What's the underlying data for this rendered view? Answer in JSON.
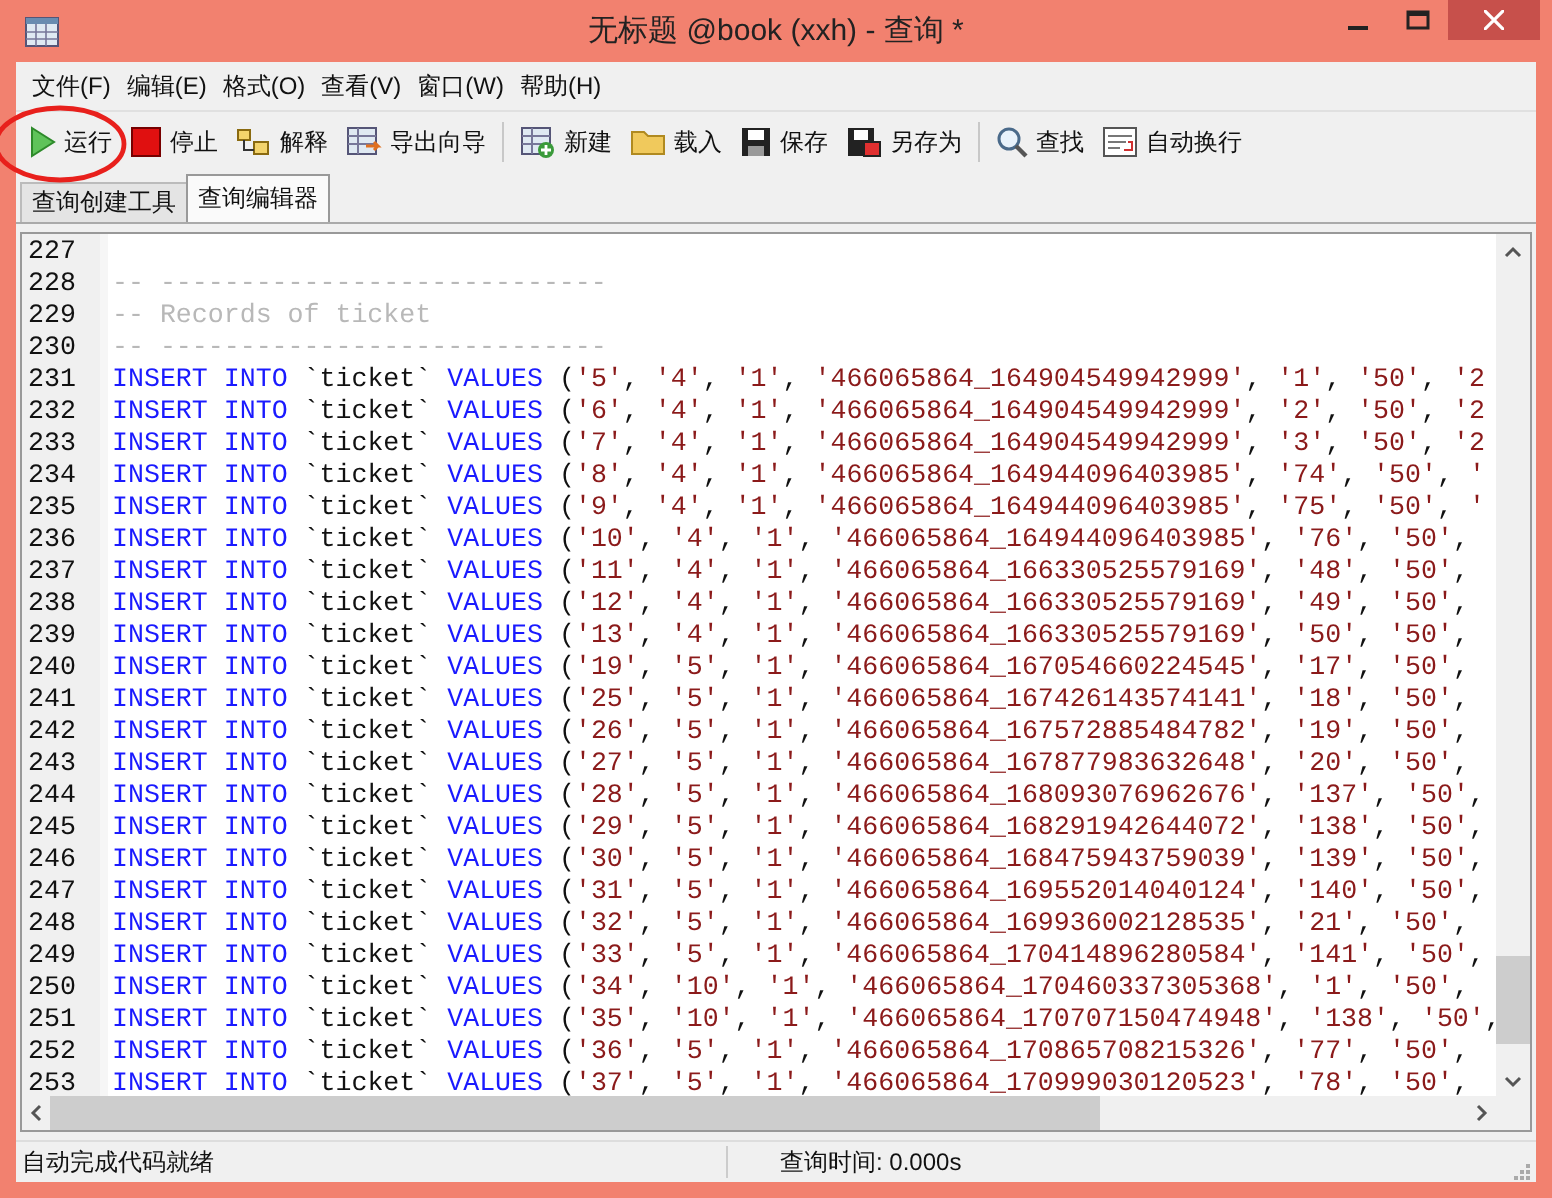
{
  "window": {
    "title": "无标题 @book (xxh) - 查询 *"
  },
  "menu": [
    "文件(F)",
    "编辑(E)",
    "格式(O)",
    "查看(V)",
    "窗口(W)",
    "帮助(H)"
  ],
  "toolbar": [
    [
      "运行",
      "停止",
      "解释",
      "导出向导"
    ],
    [
      "新建",
      "载入",
      "保存",
      "另存为"
    ],
    [
      "查找",
      "自动换行"
    ]
  ],
  "tabs": [
    {
      "label": "查询创建工具",
      "selected": false
    },
    {
      "label": "查询编辑器",
      "selected": true
    }
  ],
  "editor": {
    "lines": [
      {
        "number": "227",
        "kind": "blank"
      },
      {
        "number": "228",
        "kind": "comment",
        "text": "-- ----------------------------"
      },
      {
        "number": "229",
        "kind": "comment",
        "text": "-- Records of ticket"
      },
      {
        "number": "230",
        "kind": "comment",
        "text": "-- ----------------------------"
      },
      {
        "number": "231",
        "kind": "code",
        "text": "INSERT INTO `ticket` VALUES ('5', '4', '1', '466065864_164904549942999', '1', '50', '2"
      },
      {
        "number": "232",
        "kind": "code",
        "text": "INSERT INTO `ticket` VALUES ('6', '4', '1', '466065864_164904549942999', '2', '50', '2"
      },
      {
        "number": "233",
        "kind": "code",
        "text": "INSERT INTO `ticket` VALUES ('7', '4', '1', '466065864_164904549942999', '3', '50', '2"
      },
      {
        "number": "234",
        "kind": "code",
        "text": "INSERT INTO `ticket` VALUES ('8', '4', '1', '466065864_164944096403985', '74', '50', '"
      },
      {
        "number": "235",
        "kind": "code",
        "text": "INSERT INTO `ticket` VALUES ('9', '4', '1', '466065864_164944096403985', '75', '50', '"
      },
      {
        "number": "236",
        "kind": "code",
        "text": "INSERT INTO `ticket` VALUES ('10', '4', '1', '466065864_164944096403985', '76', '50',"
      },
      {
        "number": "237",
        "kind": "code",
        "text": "INSERT INTO `ticket` VALUES ('11', '4', '1', '466065864_166330525579169', '48', '50',"
      },
      {
        "number": "238",
        "kind": "code",
        "text": "INSERT INTO `ticket` VALUES ('12', '4', '1', '466065864_166330525579169', '49', '50',"
      },
      {
        "number": "239",
        "kind": "code",
        "text": "INSERT INTO `ticket` VALUES ('13', '4', '1', '466065864_166330525579169', '50', '50',"
      },
      {
        "number": "240",
        "kind": "code",
        "text": "INSERT INTO `ticket` VALUES ('19', '5', '1', '466065864_167054660224545', '17', '50',"
      },
      {
        "number": "241",
        "kind": "code",
        "text": "INSERT INTO `ticket` VALUES ('25', '5', '1', '466065864_167426143574141', '18', '50',"
      },
      {
        "number": "242",
        "kind": "code",
        "text": "INSERT INTO `ticket` VALUES ('26', '5', '1', '466065864_167572885484782', '19', '50',"
      },
      {
        "number": "243",
        "kind": "code",
        "text": "INSERT INTO `ticket` VALUES ('27', '5', '1', '466065864_167877983632648', '20', '50',"
      },
      {
        "number": "244",
        "kind": "code",
        "text": "INSERT INTO `ticket` VALUES ('28', '5', '1', '466065864_168093076962676', '137', '50',"
      },
      {
        "number": "245",
        "kind": "code",
        "text": "INSERT INTO `ticket` VALUES ('29', '5', '1', '466065864_168291942644072', '138', '50',"
      },
      {
        "number": "246",
        "kind": "code",
        "text": "INSERT INTO `ticket` VALUES ('30', '5', '1', '466065864_168475943759039', '139', '50',"
      },
      {
        "number": "247",
        "kind": "code",
        "text": "INSERT INTO `ticket` VALUES ('31', '5', '1', '466065864_169552014040124', '140', '50',"
      },
      {
        "number": "248",
        "kind": "code",
        "text": "INSERT INTO `ticket` VALUES ('32', '5', '1', '466065864_169936002128535', '21', '50',"
      },
      {
        "number": "249",
        "kind": "code",
        "text": "INSERT INTO `ticket` VALUES ('33', '5', '1', '466065864_170414896280584', '141', '50',"
      },
      {
        "number": "250",
        "kind": "code",
        "text": "INSERT INTO `ticket` VALUES ('34', '10', '1', '466065864_170460337305368', '1', '50',"
      },
      {
        "number": "251",
        "kind": "code",
        "text": "INSERT INTO `ticket` VALUES ('35', '10', '1', '466065864_170707150474948', '138', '50',"
      },
      {
        "number": "252",
        "kind": "code",
        "text": "INSERT INTO `ticket` VALUES ('36', '5', '1', '466065864_170865708215326', '77', '50',"
      },
      {
        "number": "253",
        "kind": "code",
        "text": "INSERT INTO `ticket` VALUES ('37', '5', '1', '466065864_170999030120523', '78', '50',"
      }
    ]
  },
  "status_bar": {
    "message": "自动完成代码就绪",
    "query_time": "查询时间: 0.000s"
  }
}
